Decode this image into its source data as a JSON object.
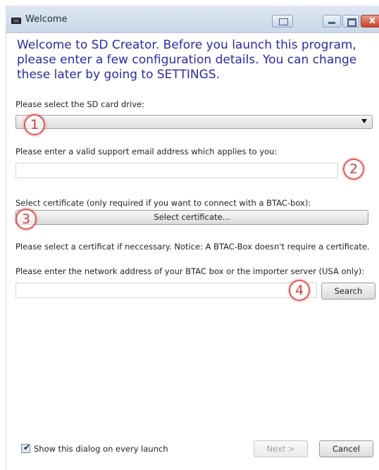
{
  "window": {
    "title": "Welcome",
    "controls": {
      "extra": "",
      "minimize": "",
      "maximize": "",
      "close": "x"
    }
  },
  "intro_text": "Welcome to SD Creator. Before you launch this program, please enter a few configuration details. You can change these later by going to SETTINGS.",
  "sd_drive": {
    "label": "Please select the SD card drive:",
    "selected_value": ""
  },
  "support_email": {
    "label": "Please enter  a valid support email address which applies to you:",
    "value": ""
  },
  "certificate": {
    "label": "Select certificate (only required if you want to connect with a BTAC-box):",
    "button_label": "Select certificate...",
    "notice": "Please select a certificat if neccessary. Notice: A BTAC-Box doesn't require a certificate."
  },
  "network": {
    "label": "Please enter the network address of your BTAC box or the importer server (USA only):",
    "value": "",
    "search_label": "Search"
  },
  "annotations": [
    "1",
    "2",
    "3",
    "4"
  ],
  "footer": {
    "show_dialog_label": "Show this dialog on every launch",
    "show_dialog_checked": true,
    "next_label": "Next >",
    "cancel_label": "Cancel"
  },
  "colors": {
    "intro_text": "#2a2aa5",
    "annotation": "#e05a5a",
    "close_button": "#c8412a"
  }
}
